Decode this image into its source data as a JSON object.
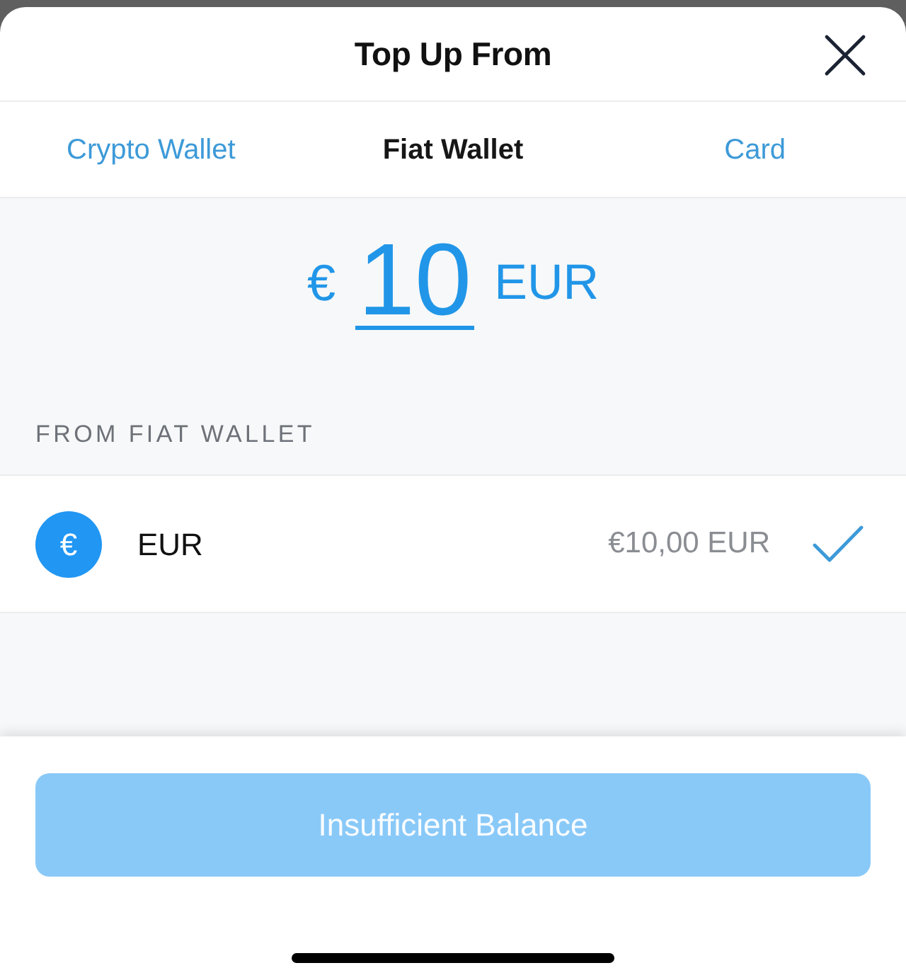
{
  "header": {
    "title": "Top Up From"
  },
  "tabs": [
    {
      "label": "Crypto Wallet",
      "selected": false
    },
    {
      "label": "Fiat Wallet",
      "selected": true
    },
    {
      "label": "Card",
      "selected": false
    }
  ],
  "amount": {
    "currency_symbol": "€",
    "value": "10",
    "currency_code": "EUR"
  },
  "section": {
    "heading": "FROM FIAT WALLET"
  },
  "accounts": [
    {
      "icon_symbol": "€",
      "name": "EUR",
      "balance": "€10,00 EUR",
      "selected": true
    }
  ],
  "action_button": {
    "label": "Insufficient Balance",
    "disabled": true
  }
}
